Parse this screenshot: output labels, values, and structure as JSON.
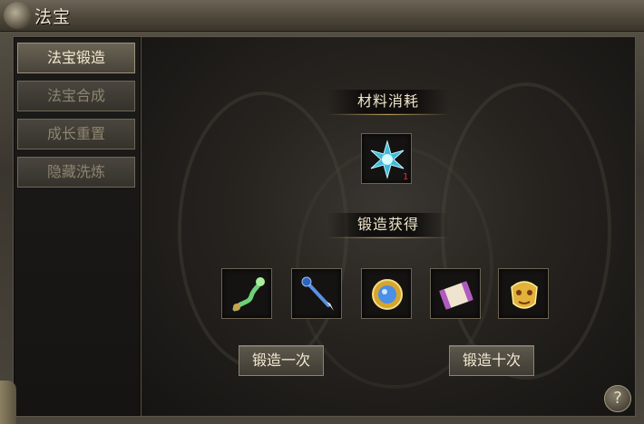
{
  "window": {
    "title": "法宝"
  },
  "sidebar": {
    "items": [
      {
        "label": "法宝锻造",
        "active": true
      },
      {
        "label": "法宝合成",
        "active": false
      },
      {
        "label": "成长重置",
        "active": false
      },
      {
        "label": "隐藏洗炼",
        "active": false
      }
    ]
  },
  "forge": {
    "materials_label": "材料消耗",
    "material": {
      "icon": "blue-crystal-icon",
      "count": "1"
    },
    "rewards_label": "锻造获得",
    "rewards": [
      {
        "icon": "green-serpent-whip-icon"
      },
      {
        "icon": "blue-spear-icon"
      },
      {
        "icon": "golden-orb-icon"
      },
      {
        "icon": "scroll-icon"
      },
      {
        "icon": "golden-mask-icon"
      }
    ],
    "forge_once_label": "锻造一次",
    "forge_ten_label": "锻造十次"
  },
  "help": {
    "label": "?"
  }
}
